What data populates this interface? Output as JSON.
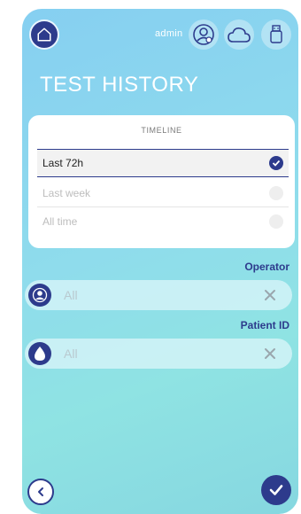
{
  "header": {
    "user_label": "admin",
    "icons": [
      "home-icon",
      "user-settings-icon",
      "cloud-icon",
      "usb-icon"
    ]
  },
  "page": {
    "title": "TEST HISTORY"
  },
  "timeline": {
    "header": "TIMELINE",
    "options": [
      {
        "label": "Last 72h",
        "selected": true
      },
      {
        "label": "Last week",
        "selected": false
      },
      {
        "label": "All time",
        "selected": false
      }
    ]
  },
  "operator": {
    "label": "Operator",
    "value": "All"
  },
  "patient": {
    "label": "Patient ID",
    "value": "All"
  },
  "colors": {
    "accent": "#2d3b8c",
    "background_start": "#86cff1",
    "background_end": "#86d7e0"
  }
}
